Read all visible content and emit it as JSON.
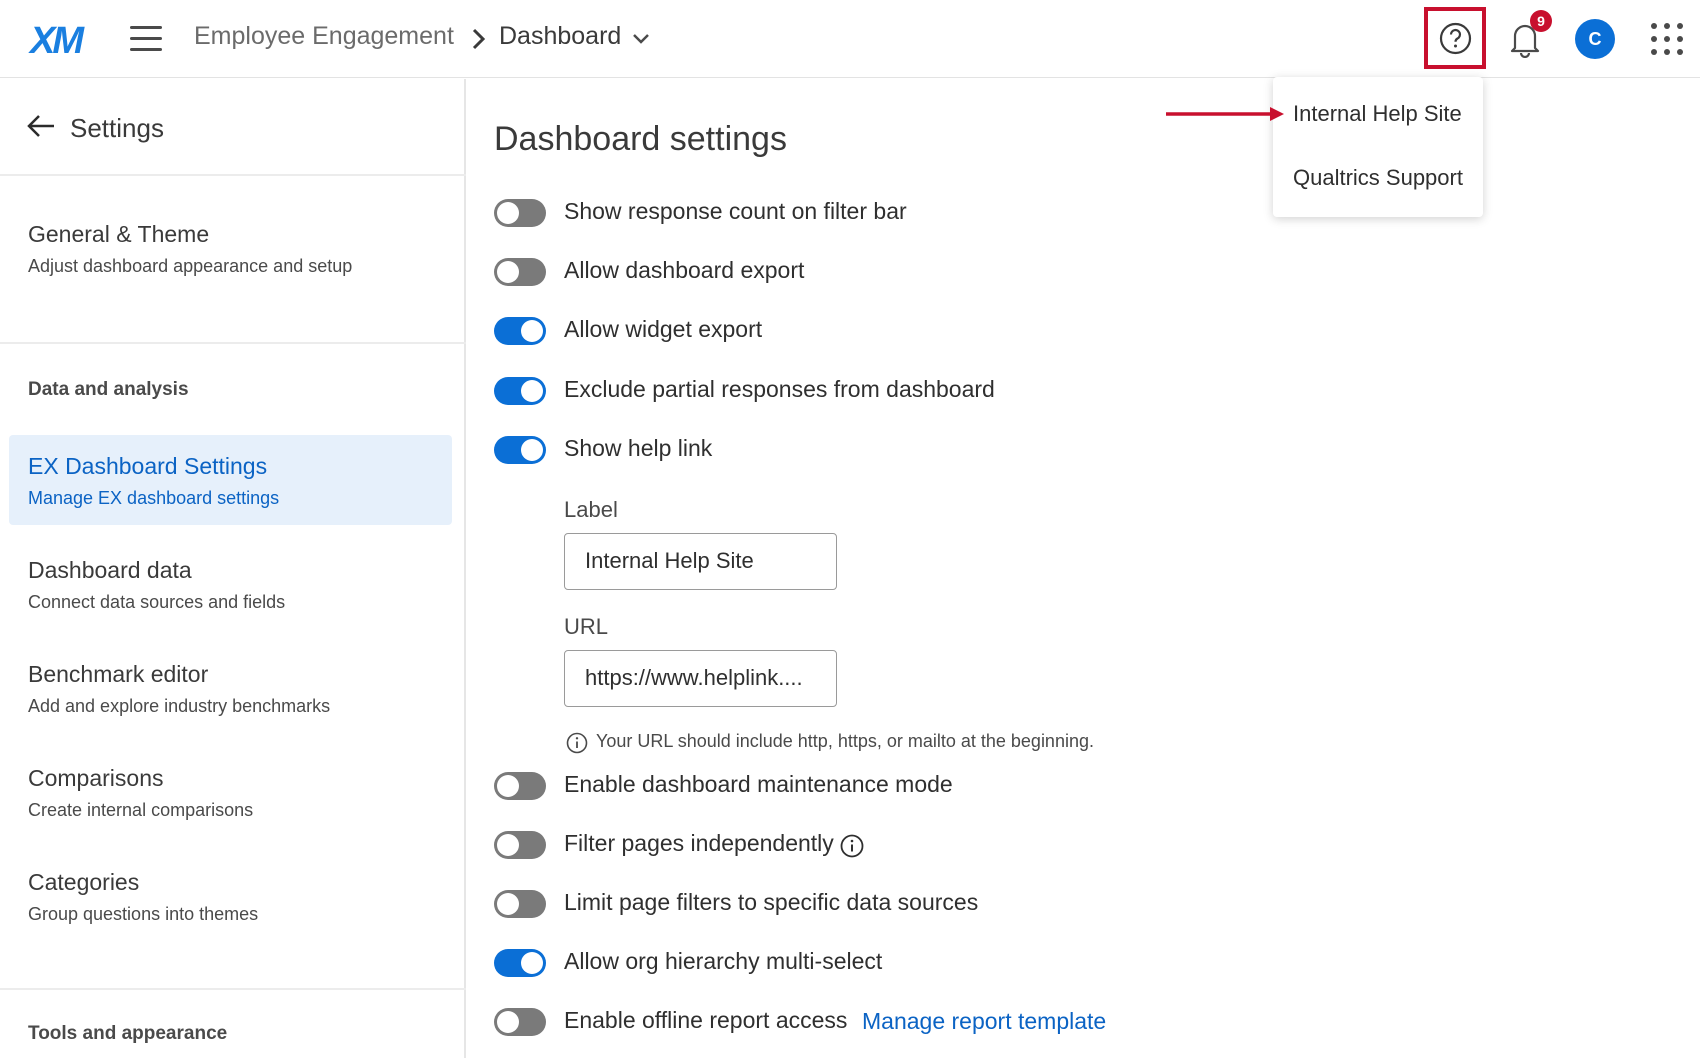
{
  "header": {
    "logo": "XM",
    "breadcrumb_parent": "Employee Engagement",
    "breadcrumb_current": "Dashboard",
    "notification_count": "9",
    "avatar_initial": "C",
    "icons": [
      "menu-icon",
      "chevron-right-icon",
      "chevron-down-icon",
      "help-icon",
      "bell-icon",
      "apps-grid-icon"
    ]
  },
  "help_menu": {
    "items": [
      "Internal Help Site",
      "Qualtrics Support"
    ]
  },
  "sidebar": {
    "title": "Settings",
    "items": [
      {
        "title": "General & Theme",
        "subtitle": "Adjust dashboard appearance and setup"
      },
      {
        "title": "EX Dashboard Settings",
        "subtitle": "Manage EX dashboard settings"
      },
      {
        "title": "Dashboard data",
        "subtitle": "Connect data sources and fields"
      },
      {
        "title": "Benchmark editor",
        "subtitle": "Add and explore industry benchmarks"
      },
      {
        "title": "Comparisons",
        "subtitle": "Create internal comparisons"
      },
      {
        "title": "Categories",
        "subtitle": "Group questions into themes"
      }
    ],
    "sections": [
      "Data and analysis",
      "Tools and appearance"
    ],
    "active_item": "EX Dashboard Settings"
  },
  "main": {
    "title": "Dashboard settings",
    "settings": [
      {
        "label": "Show response count on filter bar",
        "enabled": false
      },
      {
        "label": "Allow dashboard export",
        "enabled": false
      },
      {
        "label": "Allow widget export",
        "enabled": true
      },
      {
        "label": "Exclude partial responses from dashboard",
        "enabled": true
      },
      {
        "label": "Show help link",
        "enabled": true
      },
      {
        "label": "Enable dashboard maintenance mode",
        "enabled": false
      },
      {
        "label": "Filter pages independently",
        "enabled": false
      },
      {
        "label": "Limit page filters to specific data sources",
        "enabled": false
      },
      {
        "label": "Allow org hierarchy multi-select",
        "enabled": true
      },
      {
        "label": "Enable offline report access",
        "enabled": false
      }
    ],
    "help_link": {
      "label_caption": "Label",
      "label_value": "Internal Help Site",
      "url_caption": "URL",
      "url_value": "https://www.helplink....",
      "hint": "Your URL should include http, https, or mailto at the beginning."
    },
    "manage_template_link": "Manage report template"
  },
  "colors": {
    "accent": "#0b6fd6",
    "highlight_border": "#c8102e",
    "toggle_off": "#7a7a7a",
    "active_bg": "#e6f0fb"
  }
}
